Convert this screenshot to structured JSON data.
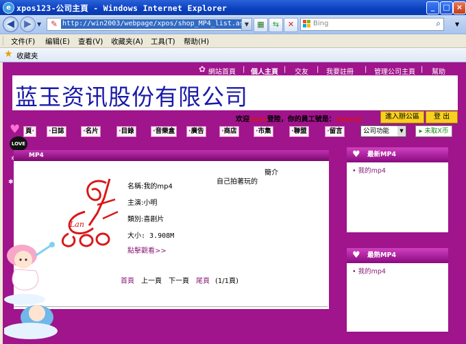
{
  "window": {
    "title": "xpos123-公司主頁 - Windows Internet Explorer",
    "buttons": [
      "_",
      "□",
      "×"
    ]
  },
  "addressbar": {
    "url": "http://win2003/webpage/xpos/shop_MP4_list.asp",
    "search_placeholder": "Bing"
  },
  "menubar": {
    "items": [
      "文件(F)",
      "编辑(E)",
      "查看(V)",
      "收藏夹(A)",
      "工具(T)",
      "帮助(H)"
    ]
  },
  "favorites": {
    "label": "收藏夹"
  },
  "site": {
    "toplinks": [
      "網站首頁",
      "個人主頁",
      "交友",
      "我要註冊",
      "管理公司主頁",
      "幫助"
    ],
    "company_name": "蓝玉资讯股份有限公司",
    "welcome_prefix": "欢迎",
    "welcome_name": "xxxx",
    "welcome_mid": "登陸，你的員工號是：",
    "welcome_id": "xxxxxx",
    "office_button": "進入辦公區",
    "logout_button": "登 出",
    "nav": [
      "頁",
      "日誌",
      "名片",
      "目錄",
      "音樂盒",
      "廣告",
      "商店",
      "市集",
      "聯盟",
      "留言"
    ],
    "function_select": "公司功能",
    "cancel_button": "未取X币",
    "love_badge": "LOVE"
  },
  "main": {
    "header": "MP4",
    "name_label": "名稱:我的mp4",
    "actor_label": "主演:小明",
    "type_label": "類別:喜剧片",
    "size_label": "大小: 3.908M",
    "desc_label": "簡介",
    "desc_text": "自己拍著玩的",
    "watch_link": "點擊觀看>>",
    "pager": {
      "first": "首頁",
      "prev": "上一頁",
      "next": "下一頁",
      "last": "尾頁",
      "count": "(1/1頁)"
    }
  },
  "sidebar": {
    "newest_title": "最新MP4",
    "newest_items": [
      "我的mp4"
    ],
    "hottest_title": "最熱MP4",
    "hottest_items": [
      "我的mp4"
    ]
  },
  "colors": {
    "page_bg": "#a0148c",
    "title_bar": "#0a3fbf",
    "company_text": "#1a1aa8",
    "accent_yellow": "#f8d020"
  }
}
